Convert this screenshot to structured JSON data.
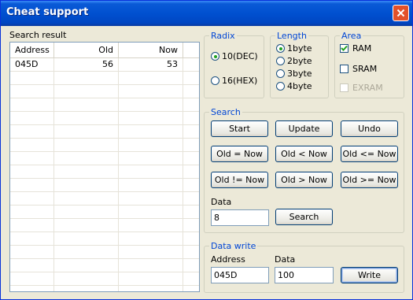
{
  "window": {
    "title": "Cheat support"
  },
  "search_result": {
    "label": "Search result",
    "columns": [
      "Address",
      "Old",
      "Now"
    ],
    "rows": [
      {
        "address": "045D",
        "old": "56",
        "now": "53"
      }
    ]
  },
  "radix": {
    "title": "Radix",
    "options": [
      "10(DEC)",
      "16(HEX)"
    ],
    "selected": "10(DEC)"
  },
  "length": {
    "title": "Length",
    "options": [
      "1byte",
      "2byte",
      "3byte",
      "4byte"
    ],
    "selected": "1byte"
  },
  "area": {
    "title": "Area",
    "options": [
      {
        "label": "RAM",
        "checked": true,
        "enabled": true
      },
      {
        "label": "SRAM",
        "checked": false,
        "enabled": true
      },
      {
        "label": "EXRAM",
        "checked": false,
        "enabled": false
      }
    ]
  },
  "search": {
    "title": "Search",
    "buttons": [
      "Start",
      "Update",
      "Undo",
      "Old = Now",
      "Old < Now",
      "Old <= Now",
      "Old != Now",
      "Old > Now",
      "Old >= Now"
    ],
    "data_label": "Data",
    "data_value": "8",
    "search_button": "Search"
  },
  "data_write": {
    "title": "Data write",
    "address_label": "Address",
    "address_value": "045D",
    "data_label": "Data",
    "data_value": "100",
    "write_button": "Write"
  },
  "colors": {
    "titlebar": "#0050d0",
    "close": "#e2512a",
    "group_title": "#0046d5",
    "face": "#ece9d8"
  }
}
